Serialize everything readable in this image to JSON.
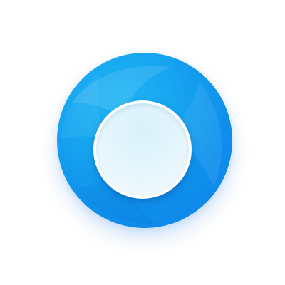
{
  "icon": {
    "name": "circular-app-icon",
    "colors": {
      "outer_ring_light": "#1fb5f3",
      "outer_ring_mid": "#16a4f0",
      "outer_ring_dark": "#0a7fe8",
      "inner_rim": "#ffffff",
      "inner_face": "#e4f5fc",
      "background": "#ffffff"
    }
  }
}
